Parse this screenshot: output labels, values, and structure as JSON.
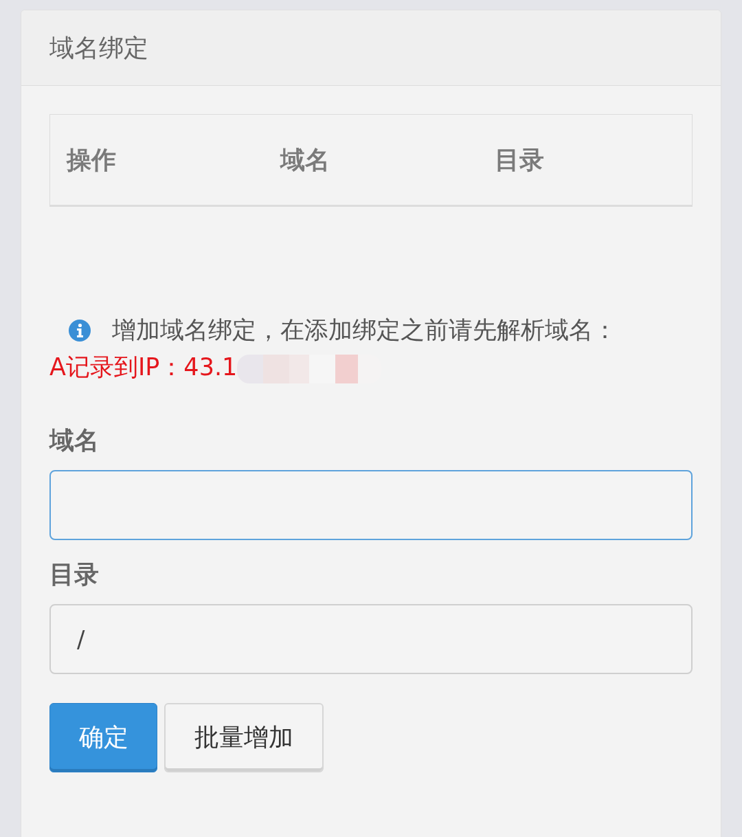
{
  "panel": {
    "title": "域名绑定"
  },
  "table": {
    "columns": [
      "操作",
      "域名",
      "目录"
    ]
  },
  "notice": {
    "text": "增加域名绑定，在添加绑定之前请先解析域名：",
    "alert": "A记录到IP：43.1"
  },
  "form": {
    "fields": [
      {
        "label": "域名",
        "focused": true
      },
      {
        "label": "目录",
        "value": "/",
        "focused": false
      }
    ]
  },
  "buttons": [
    {
      "label": "确定",
      "kind": "primary"
    },
    {
      "label": "批量增加",
      "kind": "default"
    }
  ]
}
